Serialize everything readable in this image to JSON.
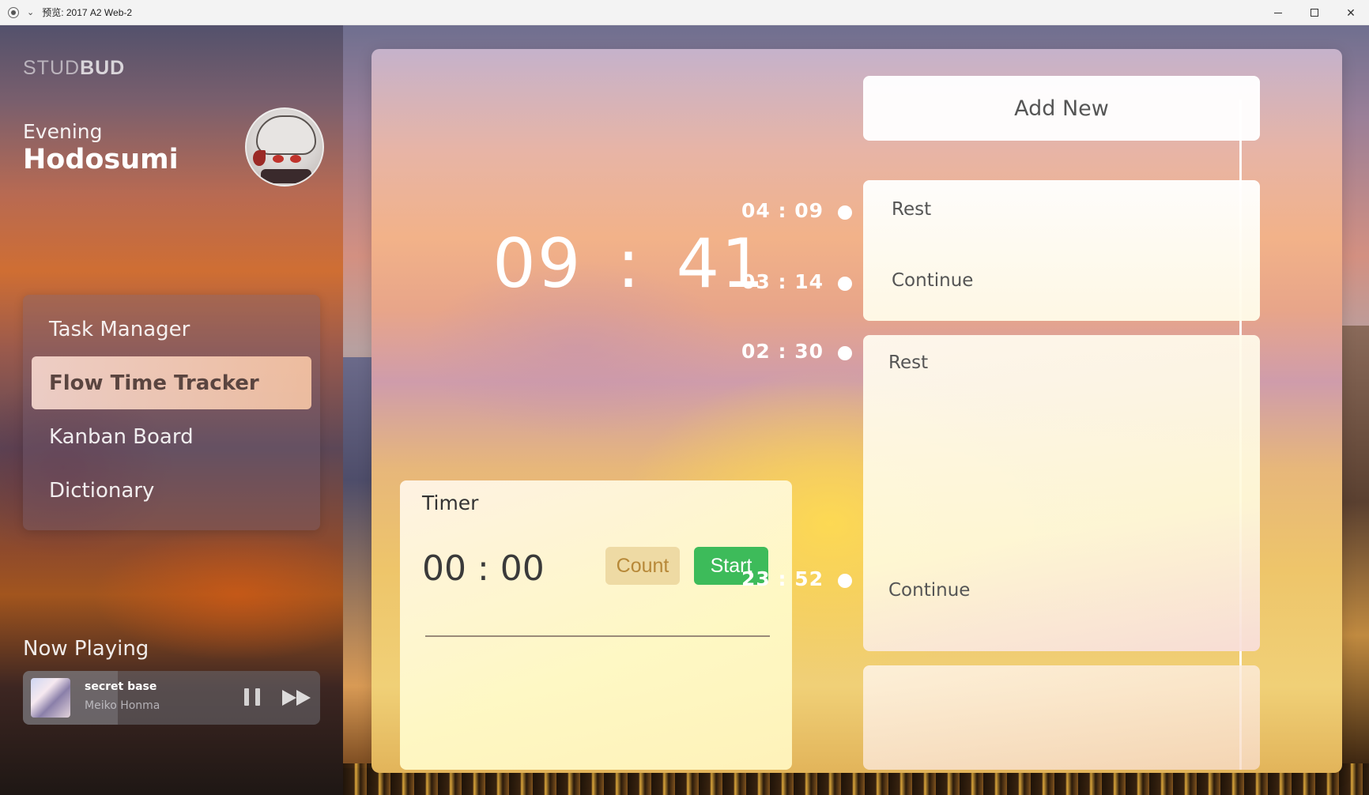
{
  "window": {
    "title": "预览: 2017 A2 Web-2",
    "minimize_icon": "minimize-icon",
    "maximize_icon": "maximize-icon",
    "close_glyph": "✕"
  },
  "sidebar": {
    "logo_light": "STUD",
    "logo_bold": "BUD",
    "greeting": "Evening",
    "user_name": "Hodosumi",
    "nav": [
      {
        "label": "Task Manager",
        "active": false
      },
      {
        "label": "Flow Time Tracker",
        "active": true
      },
      {
        "label": "Kanban Board",
        "active": false
      },
      {
        "label": "Dictionary",
        "active": false
      }
    ],
    "now_playing_title": "Now Playing",
    "player": {
      "song": "secret base",
      "artist": "Meiko Honma",
      "progress": 0.32
    }
  },
  "main": {
    "clock": {
      "hours": "09",
      "separator": ":",
      "minutes": "41"
    },
    "timer": {
      "title": "Timer",
      "value": "00 : 00",
      "count_label": "Count",
      "start_label": "Start"
    },
    "timeline": {
      "times": [
        "04 : 09",
        "03 : 14",
        "02 : 30",
        "23 : 52"
      ],
      "add_new_label": "Add New",
      "cards": [
        {
          "top_label": "Rest",
          "bottom_label": "Continue"
        },
        {
          "top_label": "Rest",
          "bottom_label": "Continue"
        }
      ]
    }
  },
  "colors": {
    "start_button": "#3dbb5a",
    "count_button_text": "#b78838",
    "active_nav_bg": "#ffd9c4"
  }
}
